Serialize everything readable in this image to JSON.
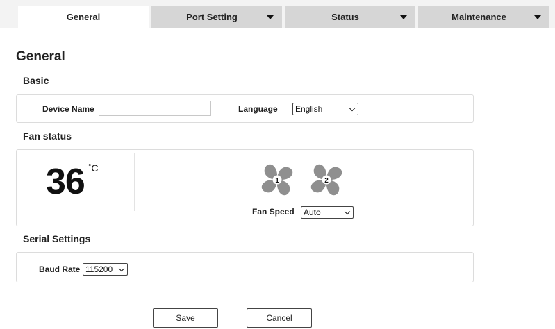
{
  "tabs": [
    {
      "label": "General",
      "active": true,
      "has_dropdown": false
    },
    {
      "label": "Port Setting",
      "active": false,
      "has_dropdown": true
    },
    {
      "label": "Status",
      "active": false,
      "has_dropdown": true
    },
    {
      "label": "Maintenance",
      "active": false,
      "has_dropdown": true
    }
  ],
  "page_title": "General",
  "basic": {
    "heading": "Basic",
    "device_name_label": "Device Name",
    "device_name_value": "",
    "language_label": "Language",
    "language_value": "English"
  },
  "fan_status": {
    "heading": "Fan status",
    "temperature": "36",
    "degree_symbol": "°",
    "unit": "C",
    "fans": [
      {
        "number": "1"
      },
      {
        "number": "2"
      }
    ],
    "fan_speed_label": "Fan Speed",
    "fan_speed_value": "Auto"
  },
  "serial": {
    "heading": "Serial Settings",
    "baud_rate_label": "Baud Rate",
    "baud_rate_value": "115200"
  },
  "actions": {
    "save_label": "Save",
    "cancel_label": "Cancel"
  },
  "icons": {
    "dropdown": "caret-down-icon",
    "fan": "fan-icon",
    "select": "chevron-down-icon"
  },
  "colors": {
    "tab_inactive": "#d6d6d6",
    "tab_active": "#ffffff",
    "fan_icon": "#8f8f8f"
  }
}
